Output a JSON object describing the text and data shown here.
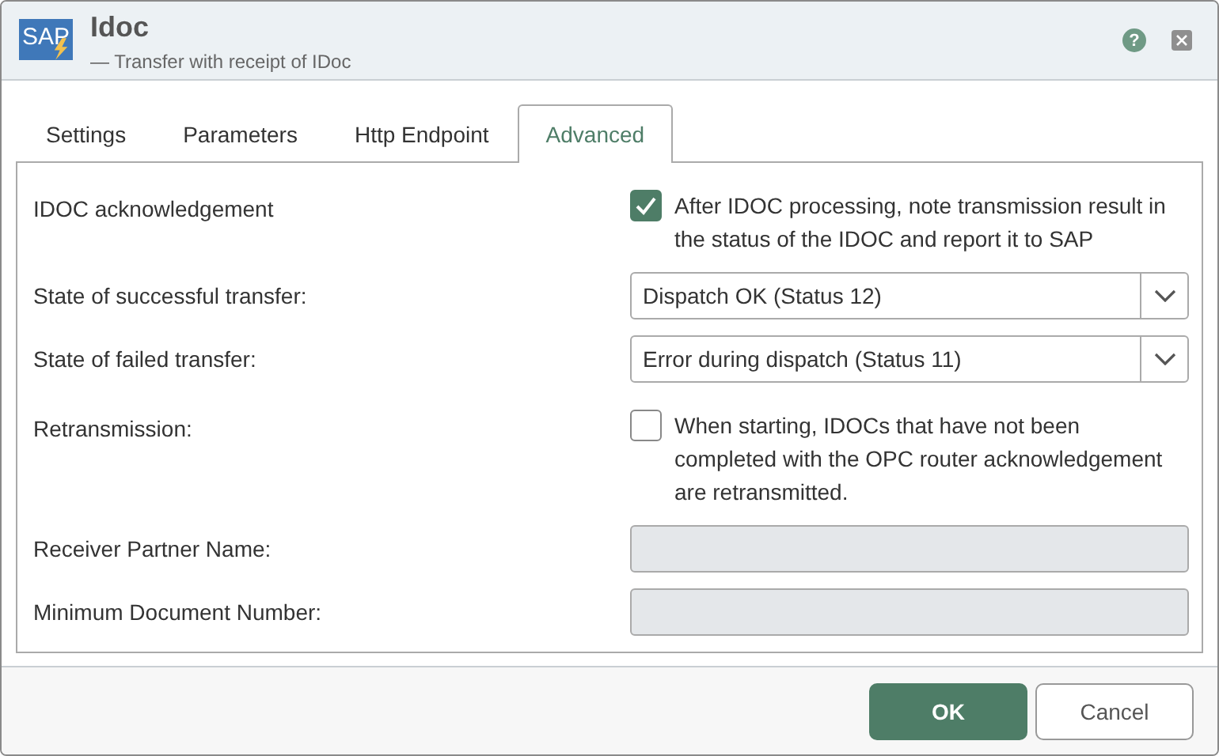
{
  "window": {
    "logo": "SAP",
    "title": "Idoc",
    "subtitle": "— Transfer with receipt of IDoc",
    "help": "?"
  },
  "tabs": [
    {
      "label": "Settings",
      "selected": false
    },
    {
      "label": "Parameters",
      "selected": false
    },
    {
      "label": "Http Endpoint",
      "selected": false
    },
    {
      "label": "Advanced",
      "selected": true
    }
  ],
  "rows": [
    {
      "kind": "checkbox",
      "label": "IDOC acknowledgement",
      "text": "After IDOC processing, note transmission result in the status of the IDOC and report it to SAP",
      "checked": true
    },
    {
      "kind": "select",
      "label": "State of successful transfer:",
      "value": "Dispatch OK (Status 12)"
    },
    {
      "kind": "select",
      "label": "State of failed transfer:",
      "value": "Error during dispatch (Status 11)"
    },
    {
      "kind": "checkbox",
      "label": "Retransmission:",
      "text": "When starting, IDOCs that have not been completed with the OPC router acknowledgement are retransmitted.",
      "checked": false
    },
    {
      "kind": "field",
      "label": "Receiver Partner Name:",
      "disabled": true
    },
    {
      "kind": "field",
      "label": "Minimum Document Number:",
      "disabled": true
    }
  ],
  "buttons": [
    {
      "label": "OK",
      "kind": "primary"
    },
    {
      "label": "Cancel",
      "kind": "secondary"
    }
  ]
}
